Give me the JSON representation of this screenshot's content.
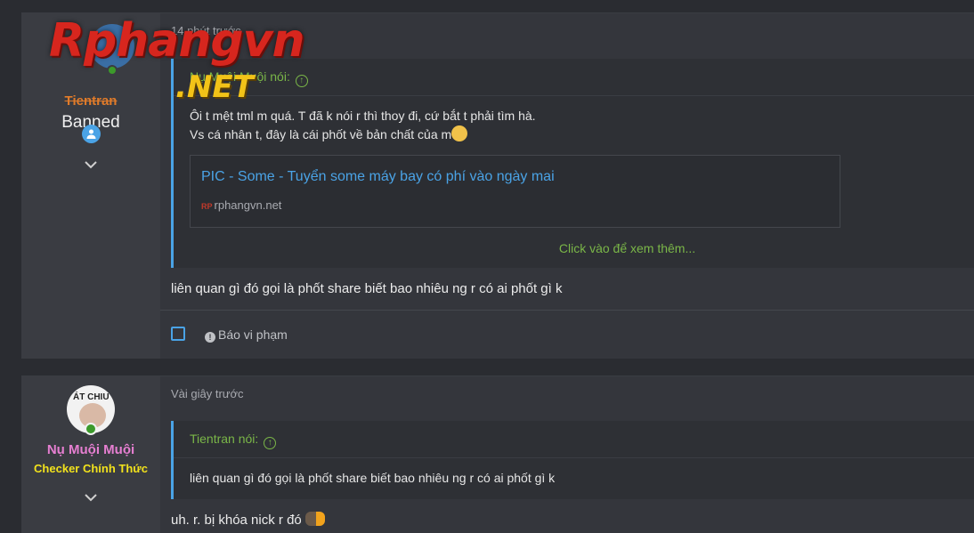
{
  "logo": {
    "main": "Rphangvn",
    "net": ".NET"
  },
  "post1": {
    "username": "Tientran",
    "user_title": "Banned",
    "time": "14 phút trước",
    "quote": {
      "author_label": "Nụ Muội Muội nói:",
      "line1": "Ôi t mệt tml m quá. T đã k nói r thì thoy đi, cứ bắt t phải tìm hà.",
      "line2": "Vs cá nhân t, đây là cái phốt về bản chất của m",
      "link_title": "PIC - Some - Tuyển some máy bay có phí vào ngày mai",
      "link_site": "rphangvn.net",
      "site_icon": "RP",
      "expand": "Click vào để xem thêm..."
    },
    "message": "liên quan gì đó gọi là phốt share biết bao nhiêu ng r có ai phốt gì k",
    "report_label": "Báo vi phạm"
  },
  "post2": {
    "avatar_text": "ÁT CHIU",
    "username": "Nụ Muội Muội",
    "user_title": "Checker Chính Thức",
    "time": "Vài giây trước",
    "quote": {
      "author_label": "Tientran nói:",
      "body": "liên quan gì đó gọi là phốt share biết bao nhiêu ng r có ai phốt gì k"
    },
    "message": "uh. r. bị khóa nick r đó"
  }
}
